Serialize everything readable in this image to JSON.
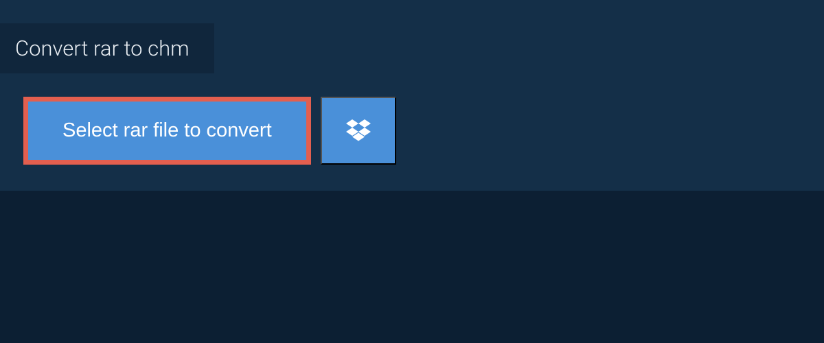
{
  "tab": {
    "title": "Convert rar to chm"
  },
  "actions": {
    "select_file_label": "Select rar file to convert"
  }
}
